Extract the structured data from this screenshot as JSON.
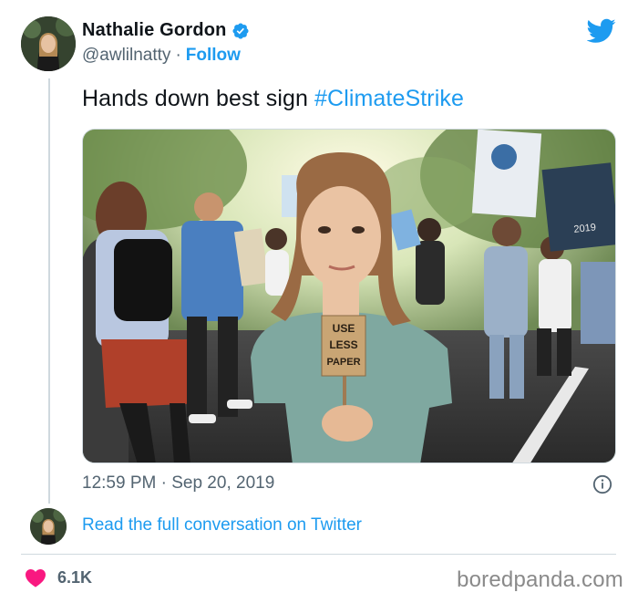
{
  "author": {
    "display_name": "Nathalie Gordon",
    "handle": "@awlilnatty",
    "separator": "·",
    "follow_label": "Follow"
  },
  "tweet": {
    "text": "Hands down best sign ",
    "hashtag": "#ClimateStrike"
  },
  "photo": {
    "sign_lines": [
      "USE",
      "LESS",
      "PAPER"
    ],
    "poster_year": "2019"
  },
  "meta": {
    "time": "12:59 PM",
    "separator": "·",
    "date": "Sep 20, 2019"
  },
  "conversation": {
    "link_label": "Read the full conversation on Twitter"
  },
  "likes": {
    "count": "6.1K"
  },
  "watermark": "boredpanda.com",
  "colors": {
    "accent": "#1d9bf0",
    "heart": "#f91880",
    "muted": "#536471",
    "border": "#cfd9de"
  },
  "icons": [
    "verified-badge-icon",
    "twitter-bird-icon",
    "info-icon",
    "heart-icon"
  ]
}
